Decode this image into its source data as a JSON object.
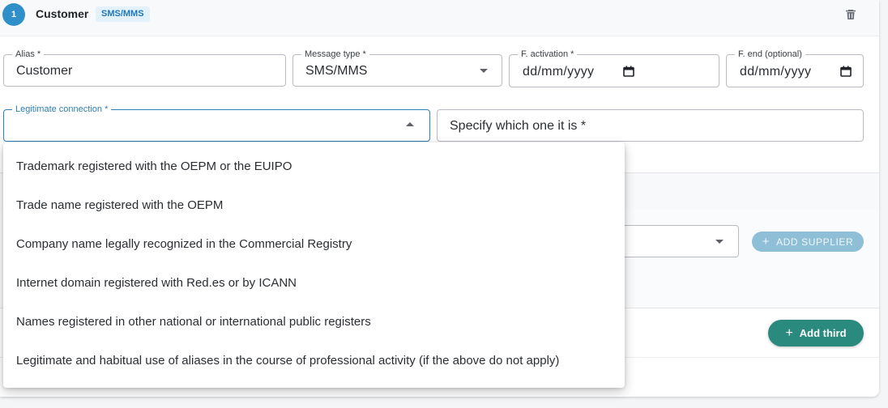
{
  "header": {
    "step_number": "1",
    "title": "Customer",
    "badge": "SMS/MMS",
    "delete_icon": "trash-icon"
  },
  "fields": {
    "alias": {
      "label": "Alias *",
      "value": "Customer"
    },
    "message_type": {
      "label": "Message type *",
      "value": "SMS/MMS"
    },
    "activation": {
      "label": "F. activation *",
      "value": "dd/mm/yyyy"
    },
    "end": {
      "label": "F. end (optional)",
      "value": "dd/mm/yyyy"
    },
    "legitimate_connection": {
      "label": "Legitimate connection *",
      "value": ""
    },
    "specify": {
      "placeholder": "Specify which one it is *"
    }
  },
  "dropdown": {
    "options": [
      "Trademark registered with the OEPM or the EUIPO",
      "Trade name registered with the OEPM",
      "Company name legally recognized in the Commercial Registry",
      "Internet domain registered with Red.es or by ICANN",
      "Names registered in other national or international public registers",
      "Legitimate and habitual use of aliases in the course of professional activity (if the above do not apply)"
    ]
  },
  "suppliers": {
    "add_label": "ADD SUPPLIER",
    "plus_icon": "plus-icon"
  },
  "third": {
    "add_label": "Add third",
    "plus_icon": "plus-icon"
  },
  "colors": {
    "accent": "#2f7fb3",
    "step_circle": "#2f8fc9",
    "add_third": "#2b8a7e",
    "add_supplier_disabled": "#8fbfd6"
  }
}
